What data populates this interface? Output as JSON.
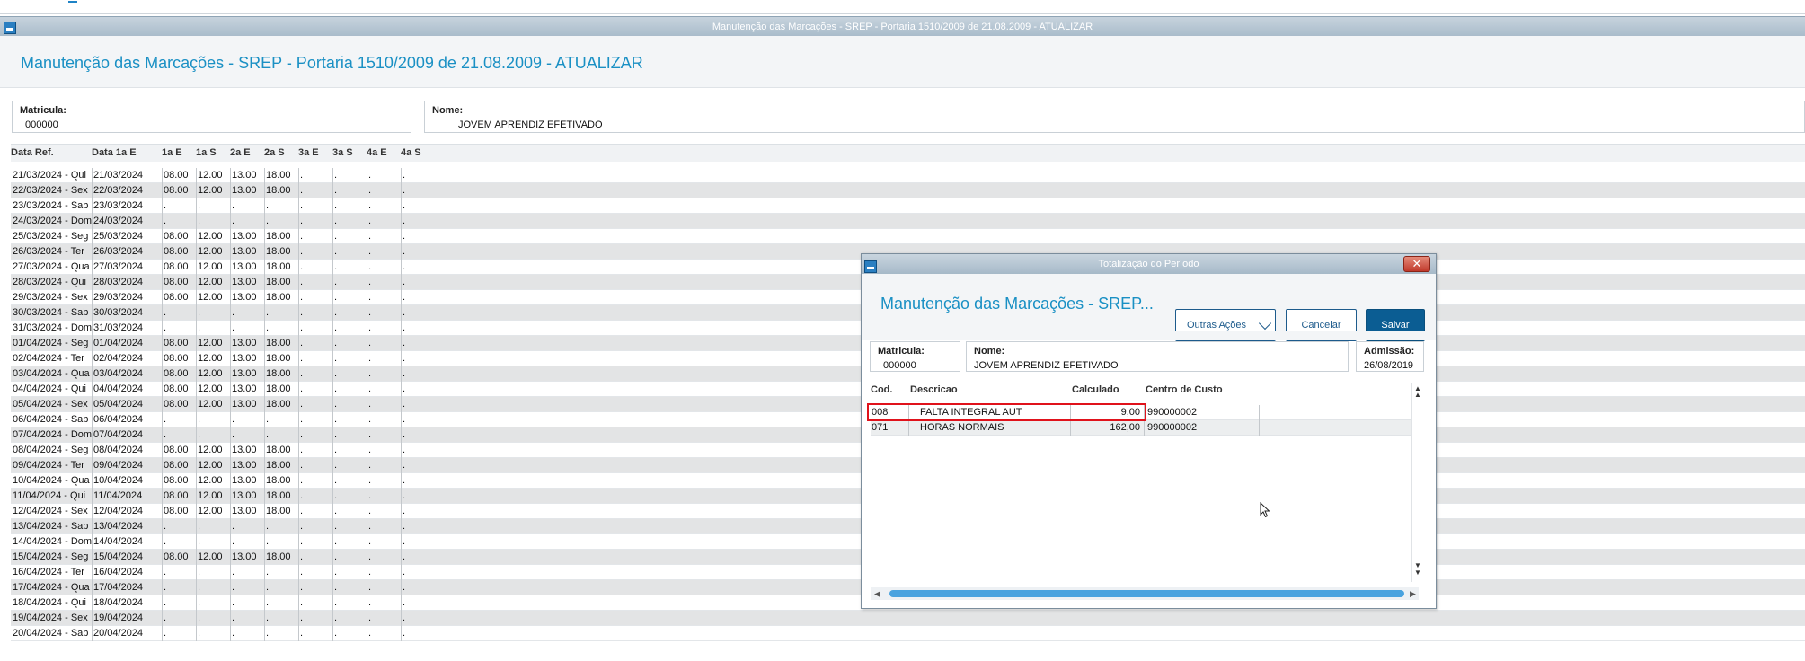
{
  "main_window": {
    "titlebar": "Manutenção das Marcações - SREP - Portaria 1510/2009 de 21.08.2009 - ATUALIZAR",
    "title": "Manutenção das Marcações - SREP - Portaria 1510/2009 de 21.08.2009 - ATUALIZAR",
    "matricula_label": "Matricula:",
    "matricula_value": "000000",
    "nome_label": "Nome:",
    "nome_value": "JOVEM APRENDIZ EFETIVADO",
    "grid_headers": [
      "Data Ref.",
      "Data 1a E",
      "1a E",
      "1a S",
      "2a E",
      "2a S",
      "3a E",
      "3a S",
      "4a E",
      "4a S"
    ],
    "rows": [
      [
        "21/03/2024 - Qui",
        "21/03/2024",
        "08.00",
        "12.00",
        "13.00",
        "18.00",
        ".",
        ".",
        ".",
        "."
      ],
      [
        "22/03/2024 - Sex",
        "22/03/2024",
        "08.00",
        "12.00",
        "13.00",
        "18.00",
        ".",
        ".",
        ".",
        "."
      ],
      [
        "23/03/2024 - Sab",
        "23/03/2024",
        ".",
        ".",
        ".",
        ".",
        ".",
        ".",
        ".",
        "."
      ],
      [
        "24/03/2024 - Dom",
        "24/03/2024",
        ".",
        ".",
        ".",
        ".",
        ".",
        ".",
        ".",
        "."
      ],
      [
        "25/03/2024 - Seg",
        "25/03/2024",
        "08.00",
        "12.00",
        "13.00",
        "18.00",
        ".",
        ".",
        ".",
        "."
      ],
      [
        "26/03/2024 - Ter",
        "26/03/2024",
        "08.00",
        "12.00",
        "13.00",
        "18.00",
        ".",
        ".",
        ".",
        "."
      ],
      [
        "27/03/2024 - Qua",
        "27/03/2024",
        "08.00",
        "12.00",
        "13.00",
        "18.00",
        ".",
        ".",
        ".",
        "."
      ],
      [
        "28/03/2024 - Qui",
        "28/03/2024",
        "08.00",
        "12.00",
        "13.00",
        "18.00",
        ".",
        ".",
        ".",
        "."
      ],
      [
        "29/03/2024 - Sex",
        "29/03/2024",
        "08.00",
        "12.00",
        "13.00",
        "18.00",
        ".",
        ".",
        ".",
        "."
      ],
      [
        "30/03/2024 - Sab",
        "30/03/2024",
        ".",
        ".",
        ".",
        ".",
        ".",
        ".",
        ".",
        "."
      ],
      [
        "31/03/2024 - Dom",
        "31/03/2024",
        ".",
        ".",
        ".",
        ".",
        ".",
        ".",
        ".",
        "."
      ],
      [
        "01/04/2024 - Seg",
        "01/04/2024",
        "08.00",
        "12.00",
        "13.00",
        "18.00",
        ".",
        ".",
        ".",
        "."
      ],
      [
        "02/04/2024 - Ter",
        "02/04/2024",
        "08.00",
        "12.00",
        "13.00",
        "18.00",
        ".",
        ".",
        ".",
        "."
      ],
      [
        "03/04/2024 - Qua",
        "03/04/2024",
        "08.00",
        "12.00",
        "13.00",
        "18.00",
        ".",
        ".",
        ".",
        "."
      ],
      [
        "04/04/2024 - Qui",
        "04/04/2024",
        "08.00",
        "12.00",
        "13.00",
        "18.00",
        ".",
        ".",
        ".",
        "."
      ],
      [
        "05/04/2024 - Sex",
        "05/04/2024",
        "08.00",
        "12.00",
        "13.00",
        "18.00",
        ".",
        ".",
        ".",
        "."
      ],
      [
        "06/04/2024 - Sab",
        "06/04/2024",
        ".",
        ".",
        ".",
        ".",
        ".",
        ".",
        ".",
        "."
      ],
      [
        "07/04/2024 - Dom",
        "07/04/2024",
        ".",
        ".",
        ".",
        ".",
        ".",
        ".",
        ".",
        "."
      ],
      [
        "08/04/2024 - Seg",
        "08/04/2024",
        "08.00",
        "12.00",
        "13.00",
        "18.00",
        ".",
        ".",
        ".",
        "."
      ],
      [
        "09/04/2024 - Ter",
        "09/04/2024",
        "08.00",
        "12.00",
        "13.00",
        "18.00",
        ".",
        ".",
        ".",
        "."
      ],
      [
        "10/04/2024 - Qua",
        "10/04/2024",
        "08.00",
        "12.00",
        "13.00",
        "18.00",
        ".",
        ".",
        ".",
        "."
      ],
      [
        "11/04/2024 - Qui",
        "11/04/2024",
        "08.00",
        "12.00",
        "13.00",
        "18.00",
        ".",
        ".",
        ".",
        "."
      ],
      [
        "12/04/2024 - Sex",
        "12/04/2024",
        "08.00",
        "12.00",
        "13.00",
        "18.00",
        ".",
        ".",
        ".",
        "."
      ],
      [
        "13/04/2024 - Sab",
        "13/04/2024",
        ".",
        ".",
        ".",
        ".",
        ".",
        ".",
        ".",
        "."
      ],
      [
        "14/04/2024 - Dom",
        "14/04/2024",
        ".",
        ".",
        ".",
        ".",
        ".",
        ".",
        ".",
        "."
      ],
      [
        "15/04/2024 - Seg",
        "15/04/2024",
        "08.00",
        "12.00",
        "13.00",
        "18.00",
        ".",
        ".",
        ".",
        "."
      ],
      [
        "16/04/2024 - Ter",
        "16/04/2024",
        ".",
        ".",
        ".",
        ".",
        ".",
        ".",
        ".",
        "."
      ],
      [
        "17/04/2024 - Qua",
        "17/04/2024",
        ".",
        ".",
        ".",
        ".",
        ".",
        ".",
        ".",
        "."
      ],
      [
        "18/04/2024 - Qui",
        "18/04/2024",
        ".",
        ".",
        ".",
        ".",
        ".",
        ".",
        ".",
        "."
      ],
      [
        "19/04/2024 - Sex",
        "19/04/2024",
        ".",
        ".",
        ".",
        ".",
        ".",
        ".",
        ".",
        "."
      ],
      [
        "20/04/2024 - Sab",
        "20/04/2024",
        ".",
        ".",
        ".",
        ".",
        ".",
        ".",
        ".",
        "."
      ]
    ]
  },
  "dialog": {
    "titlebar": "Totalização do Período",
    "title": "Manutenção das Marcações - SREP...",
    "buttons": {
      "outras_acoes": "Outras Ações",
      "cancelar": "Cancelar",
      "salvar": "Salvar"
    },
    "matricula_label": "Matricula:",
    "matricula_value": "000000",
    "nome_label": "Nome:",
    "nome_value": "JOVEM APRENDIZ EFETIVADO",
    "admissao_label": "Admissão:",
    "admissao_value": "26/08/2019",
    "grid_headers": [
      "Cod.",
      "Descricao",
      "Calculado",
      "Centro de Custo"
    ],
    "rows": [
      [
        "008",
        "FALTA INTEGRAL AUT",
        "9,00",
        "990000002"
      ],
      [
        "071",
        "HORAS NORMAIS",
        "162,00",
        "990000002"
      ]
    ]
  },
  "colors": {
    "title_blue": "#1a90c4",
    "primary_button": "#0b5d93",
    "highlight_red": "#e0121b",
    "scroll_thumb": "#4aa3df"
  }
}
